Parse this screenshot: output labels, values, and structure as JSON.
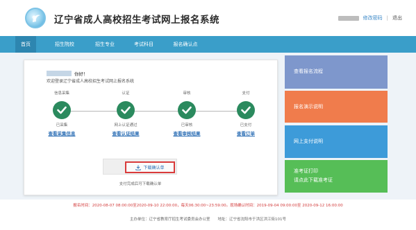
{
  "header": {
    "title": "辽宁省成人高校招生考试网上报名系统",
    "change_password": "修改密码",
    "separator": "|",
    "logout": "退出"
  },
  "nav": {
    "items": [
      {
        "label": "首页",
        "active": true
      },
      {
        "label": "招生院校",
        "active": false
      },
      {
        "label": "招生专业",
        "active": false
      },
      {
        "label": "考试科目",
        "active": false
      },
      {
        "label": "报名确认点",
        "active": false
      }
    ]
  },
  "main": {
    "greeting": "你好！",
    "welcome": "欢迎登录辽宁省成人高校招生考试网上报名系统",
    "steps": [
      {
        "label": "信息采集",
        "status": "已采集",
        "link": "查看采集信息"
      },
      {
        "label": "认证",
        "status": "网上认证通过",
        "link": "查看认证结果"
      },
      {
        "label": "审核",
        "status": "已审核",
        "link": "查看审核结果"
      },
      {
        "label": "支付",
        "status": "已支付",
        "link": "查看订单"
      }
    ],
    "download_button": "下载确认单",
    "download_hint": "支付完成后可下载确认单"
  },
  "tiles": [
    {
      "line1": "查看报名流程",
      "line2": "",
      "color": "#7e97cc"
    },
    {
      "line1": "报名演示说明",
      "line2": "",
      "color": "#f07c4c"
    },
    {
      "line1": "网上支付说明",
      "line2": "",
      "color": "#3d9bd9"
    },
    {
      "line1": "准考证打印",
      "line2": "请点此下载准考证",
      "color": "#56be57"
    }
  ],
  "notice": "报名时间：2020-08-07 08:00:00至2020-09-10 22:00:00，每天06:30:00~23:59:00。现场确认时间：2019-09-04 09:00:00至 2020-09-12 16:00:00",
  "footer": "主办单位：辽宁省教育厅招生考试委员会办公室　　地址：辽宁省沈阳市于洪区洪江街101号",
  "colors": {
    "nav": "#3a9ec9",
    "check": "#2b8a5e",
    "highlight_border": "#d93a3a"
  }
}
